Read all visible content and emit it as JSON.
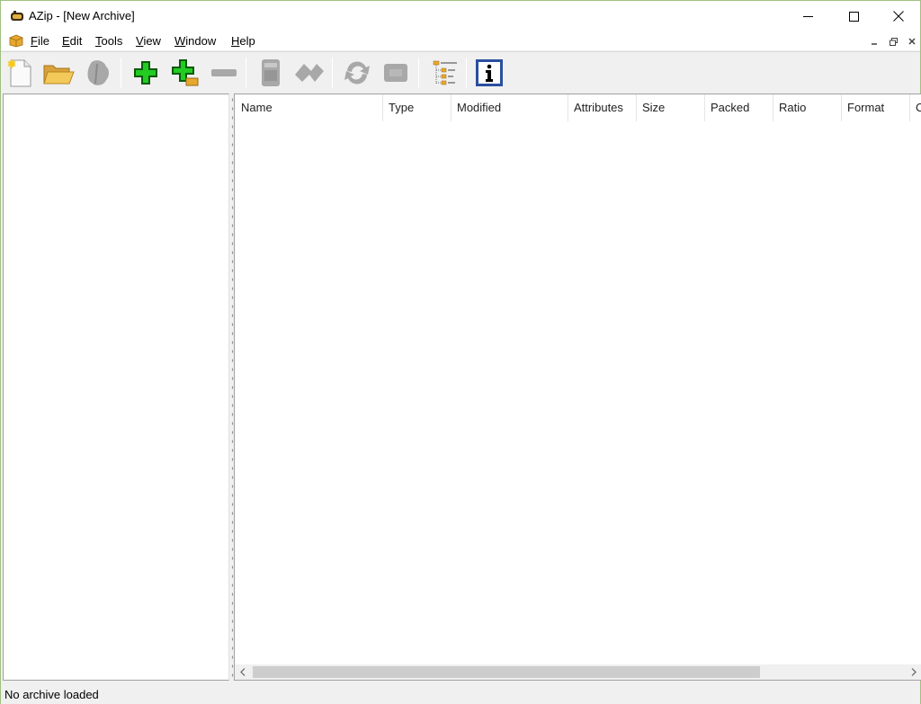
{
  "window": {
    "title": "AZip - [New Archive]"
  },
  "menu": {
    "items": [
      {
        "label": "File",
        "accel": "F",
        "rest": "ile"
      },
      {
        "label": "Edit",
        "accel": "E",
        "rest": "dit"
      },
      {
        "label": "Tools",
        "accel": "T",
        "rest": "ools"
      },
      {
        "label": "View",
        "accel": "V",
        "rest": "iew"
      },
      {
        "label": "Window",
        "accel": "W",
        "rest": "indow"
      },
      {
        "label": "Help",
        "accel": "H",
        "rest": "elp"
      }
    ]
  },
  "toolbar": {
    "buttons": [
      {
        "icon": "new-archive-icon",
        "enabled": true
      },
      {
        "icon": "open-archive-icon",
        "enabled": true
      },
      {
        "icon": "close-archive-icon",
        "enabled": false
      },
      {
        "icon": "add-files-icon",
        "enabled": true
      },
      {
        "icon": "add-folder-icon",
        "enabled": true
      },
      {
        "icon": "delete-icon",
        "enabled": false
      },
      {
        "icon": "test-archive-icon",
        "enabled": false
      },
      {
        "icon": "find-icon",
        "enabled": false
      },
      {
        "icon": "update-icon",
        "enabled": false
      },
      {
        "icon": "recompress-icon",
        "enabled": false
      },
      {
        "icon": "tree-view-icon",
        "enabled": true
      },
      {
        "icon": "properties-icon",
        "enabled": true
      }
    ]
  },
  "list": {
    "columns": [
      "Name",
      "Type",
      "Modified",
      "Attributes",
      "Size",
      "Packed",
      "Ratio",
      "Format",
      "C"
    ],
    "rows": []
  },
  "status": {
    "text": "No archive loaded"
  },
  "colors": {
    "accent_green": "#22cc22",
    "info_blue": "#2a4f9e",
    "disabled_gray": "#a8a8a8"
  }
}
